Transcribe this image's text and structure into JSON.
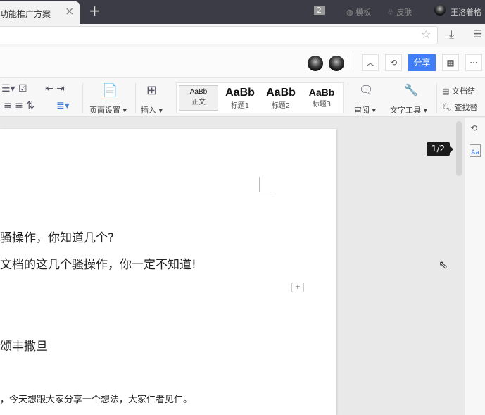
{
  "tabbar": {
    "tab_title": "功能推广方案",
    "close": "×",
    "new_tab": "+",
    "badge": "2",
    "template": "模板",
    "skin": "皮肤",
    "user": "王洛着格"
  },
  "address": {
    "star": "☆",
    "download": "⤓",
    "menu": "☰"
  },
  "header": {
    "collapse": "︿",
    "history": "⟲",
    "share": "分享",
    "qr": "▦",
    "more": "···"
  },
  "toolbar": {
    "page_setup": "页面设置",
    "insert": "插入",
    "review": "审阅",
    "text_tools": "文字工具",
    "doc_structure": "文档结",
    "find_replace": "查找替",
    "styles": [
      {
        "preview": "AaBb",
        "label": "正文"
      },
      {
        "preview": "AaBb",
        "label": "标题1"
      },
      {
        "preview": "AaBb",
        "label": "标题2"
      },
      {
        "preview": "AaBb",
        "label": "标题3"
      }
    ]
  },
  "document": {
    "lines": [
      "骚操作，你知道几个?",
      "文档的这几个骚操作，你一定不知道!",
      "颂丰撒旦",
      "，今天想跟大家分享一个想法，大家仁者见仁。"
    ],
    "add_comment": "+"
  },
  "page_indicator": "1/2",
  "colors": {
    "accent": "#3f7ef6",
    "tabbar": "#3b3c45"
  }
}
